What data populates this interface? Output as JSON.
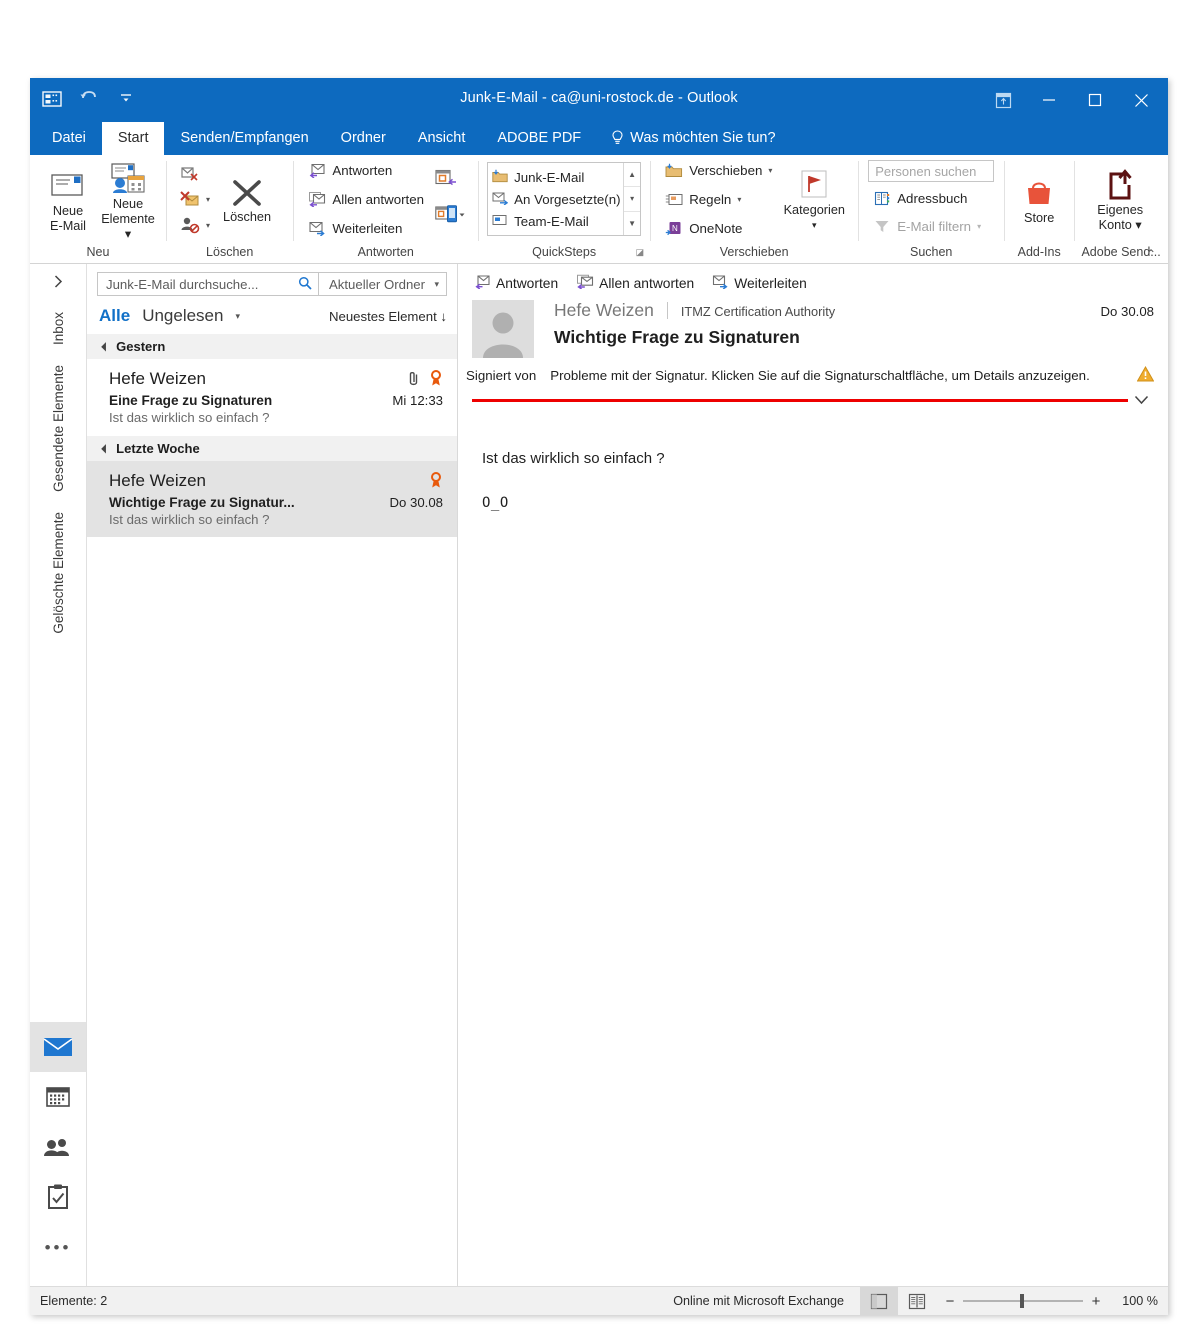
{
  "window": {
    "title": "Junk-E-Mail - ca@uni-rostock.de - Outlook",
    "quick_access": [
      "touch-mode-icon",
      "undo-icon",
      "customize-qat-icon"
    ],
    "controls": [
      "ribbon-display-options-icon",
      "minimize-icon",
      "maximize-icon",
      "close-icon"
    ]
  },
  "tabs": [
    {
      "label": "Datei",
      "active": false
    },
    {
      "label": "Start",
      "active": true
    },
    {
      "label": "Senden/Empfangen",
      "active": false
    },
    {
      "label": "Ordner",
      "active": false
    },
    {
      "label": "Ansicht",
      "active": false
    },
    {
      "label": "ADOBE PDF",
      "active": false
    }
  ],
  "tell_me": "Was möchten Sie tun?",
  "ribbon": {
    "groups": [
      {
        "label": "Neu",
        "big_buttons": [
          {
            "label": "Neue\nE-Mail",
            "line1": "Neue",
            "line2": "E-Mail",
            "icon": "new-email-icon"
          },
          {
            "label": "Neue Elemente",
            "line1": "Neue",
            "line2": "Elemente ▾",
            "icon": "new-items-icon"
          }
        ]
      },
      {
        "label": "Löschen",
        "small_buttons": [
          {
            "label": "",
            "icon": "ignore-icon"
          },
          {
            "label": "",
            "icon": "junk-icon",
            "caret": true
          },
          {
            "label": "",
            "icon": "clean-up-icon",
            "caret": true
          }
        ],
        "big_buttons": [
          {
            "line1": "",
            "line2": "Löschen",
            "icon": "delete-x-icon"
          }
        ]
      },
      {
        "label": "Antworten",
        "small_buttons": [
          {
            "label": "Antworten",
            "icon": "reply-icon"
          },
          {
            "label": "Allen antworten",
            "icon": "reply-all-icon"
          },
          {
            "label": "Weiterleiten",
            "icon": "forward-icon"
          }
        ],
        "extra_icons": [
          "meeting-reply-icon",
          "more-respond-icon"
        ]
      },
      {
        "label": "QuickSteps",
        "has_dialog_launcher": true,
        "items": [
          {
            "label": "Junk-E-Mail",
            "icon": "folder-move-icon"
          },
          {
            "label": "An Vorgesetzte(n)",
            "icon": "forward-manager-icon"
          },
          {
            "label": "Team-E-Mail",
            "icon": "team-email-icon"
          }
        ]
      },
      {
        "label": "Verschieben",
        "small_buttons": [
          {
            "label": "Verschieben",
            "icon": "move-folder-icon",
            "caret": true
          },
          {
            "label": "Regeln",
            "icon": "rules-icon",
            "caret": true
          },
          {
            "label": "OneNote",
            "icon": "onenote-icon"
          }
        ],
        "big_buttons": [
          {
            "line1": "Kategorien",
            "line2": "▾",
            "icon": "categorize-flag-icon"
          }
        ]
      },
      {
        "label": "Suchen",
        "search_placeholder": "Personen suchen",
        "small_buttons": [
          {
            "label": "Adressbuch",
            "icon": "address-book-icon"
          },
          {
            "label": "E-Mail filtern",
            "icon": "filter-funnel-icon",
            "caret": true,
            "disabled": true
          }
        ]
      },
      {
        "label": "Add-Ins",
        "big_buttons": [
          {
            "line1": "",
            "line2": "Store",
            "icon": "store-bag-icon"
          }
        ]
      },
      {
        "label": "Adobe Send...",
        "big_buttons": [
          {
            "line1": "Eigenes",
            "line2": "Konto ▾",
            "icon": "adobe-send-icon"
          }
        ]
      }
    ],
    "collapse_icon": "chevron-up-icon"
  },
  "rail": {
    "expand_icon": "chevron-right-icon",
    "folders": [
      "Inbox",
      "Gesendete Elemente",
      "Gelöschte Elemente"
    ],
    "nav": [
      {
        "name": "mail-nav-icon",
        "selected": true
      },
      {
        "name": "calendar-nav-icon",
        "selected": false
      },
      {
        "name": "people-nav-icon",
        "selected": false
      },
      {
        "name": "tasks-nav-icon",
        "selected": false
      },
      {
        "name": "more-nav-icon",
        "selected": false,
        "glyph": "•••"
      }
    ]
  },
  "message_list": {
    "search_placeholder": "Junk-E-Mail durchsuche...",
    "search_icon": "search-icon",
    "scope": "Aktueller Ordner",
    "scope_caret": "▾",
    "filter_all": "Alle",
    "filter_unread": "Ungelesen",
    "sort": "Neuestes Element ↓",
    "groups": [
      {
        "title": "Gestern",
        "items": [
          {
            "from": "Hefe Weizen",
            "subject": "Eine Frage zu Signaturen",
            "preview": "Ist das wirklich so einfach ?",
            "date": "Mi 12:33",
            "has_attachment": true,
            "is_signed": true,
            "selected": false
          }
        ]
      },
      {
        "title": "Letzte Woche",
        "items": [
          {
            "from": "Hefe Weizen",
            "subject": "Wichtige Frage zu Signatur...",
            "preview": "Ist das wirklich so einfach ?",
            "date": "Do 30.08",
            "has_attachment": false,
            "is_signed": true,
            "selected": true
          }
        ]
      }
    ]
  },
  "reading_pane": {
    "actions": [
      {
        "label": "Antworten",
        "icon": "reply-icon"
      },
      {
        "label": "Allen antworten",
        "icon": "reply-all-icon"
      },
      {
        "label": "Weiterleiten",
        "icon": "forward-icon"
      }
    ],
    "sender": "Hefe Weizen",
    "organization": "ITMZ Certification Authority",
    "date": "Do 30.08",
    "subject": "Wichtige Frage zu Signaturen",
    "signature_label": "Signiert von",
    "signature_warning": "Probleme mit der Signatur. Klicken Sie auf die Signaturschaltfläche, um Details anzuzeigen.",
    "signature_warning_icon": "warning-triangle-icon",
    "expand_icon": "chevron-down-icon",
    "avatar_icon": "person-avatar-icon",
    "body_lines": [
      "Ist das wirklich so einfach ?",
      "O_O"
    ]
  },
  "status_bar": {
    "items_count": "Elemente: 2",
    "connection": "Online mit Microsoft Exchange",
    "view_normal_icon": "normal-view-icon",
    "view_reading_icon": "reading-view-icon",
    "zoom_out": "−",
    "zoom_in": "+",
    "zoom_level": "100 %"
  },
  "colors": {
    "accent": "#0d6abf",
    "filter_active": "#1170c7",
    "signature_red": "#ee0000",
    "signed_badge": "#e8590c",
    "store_orange": "#e8533a"
  }
}
